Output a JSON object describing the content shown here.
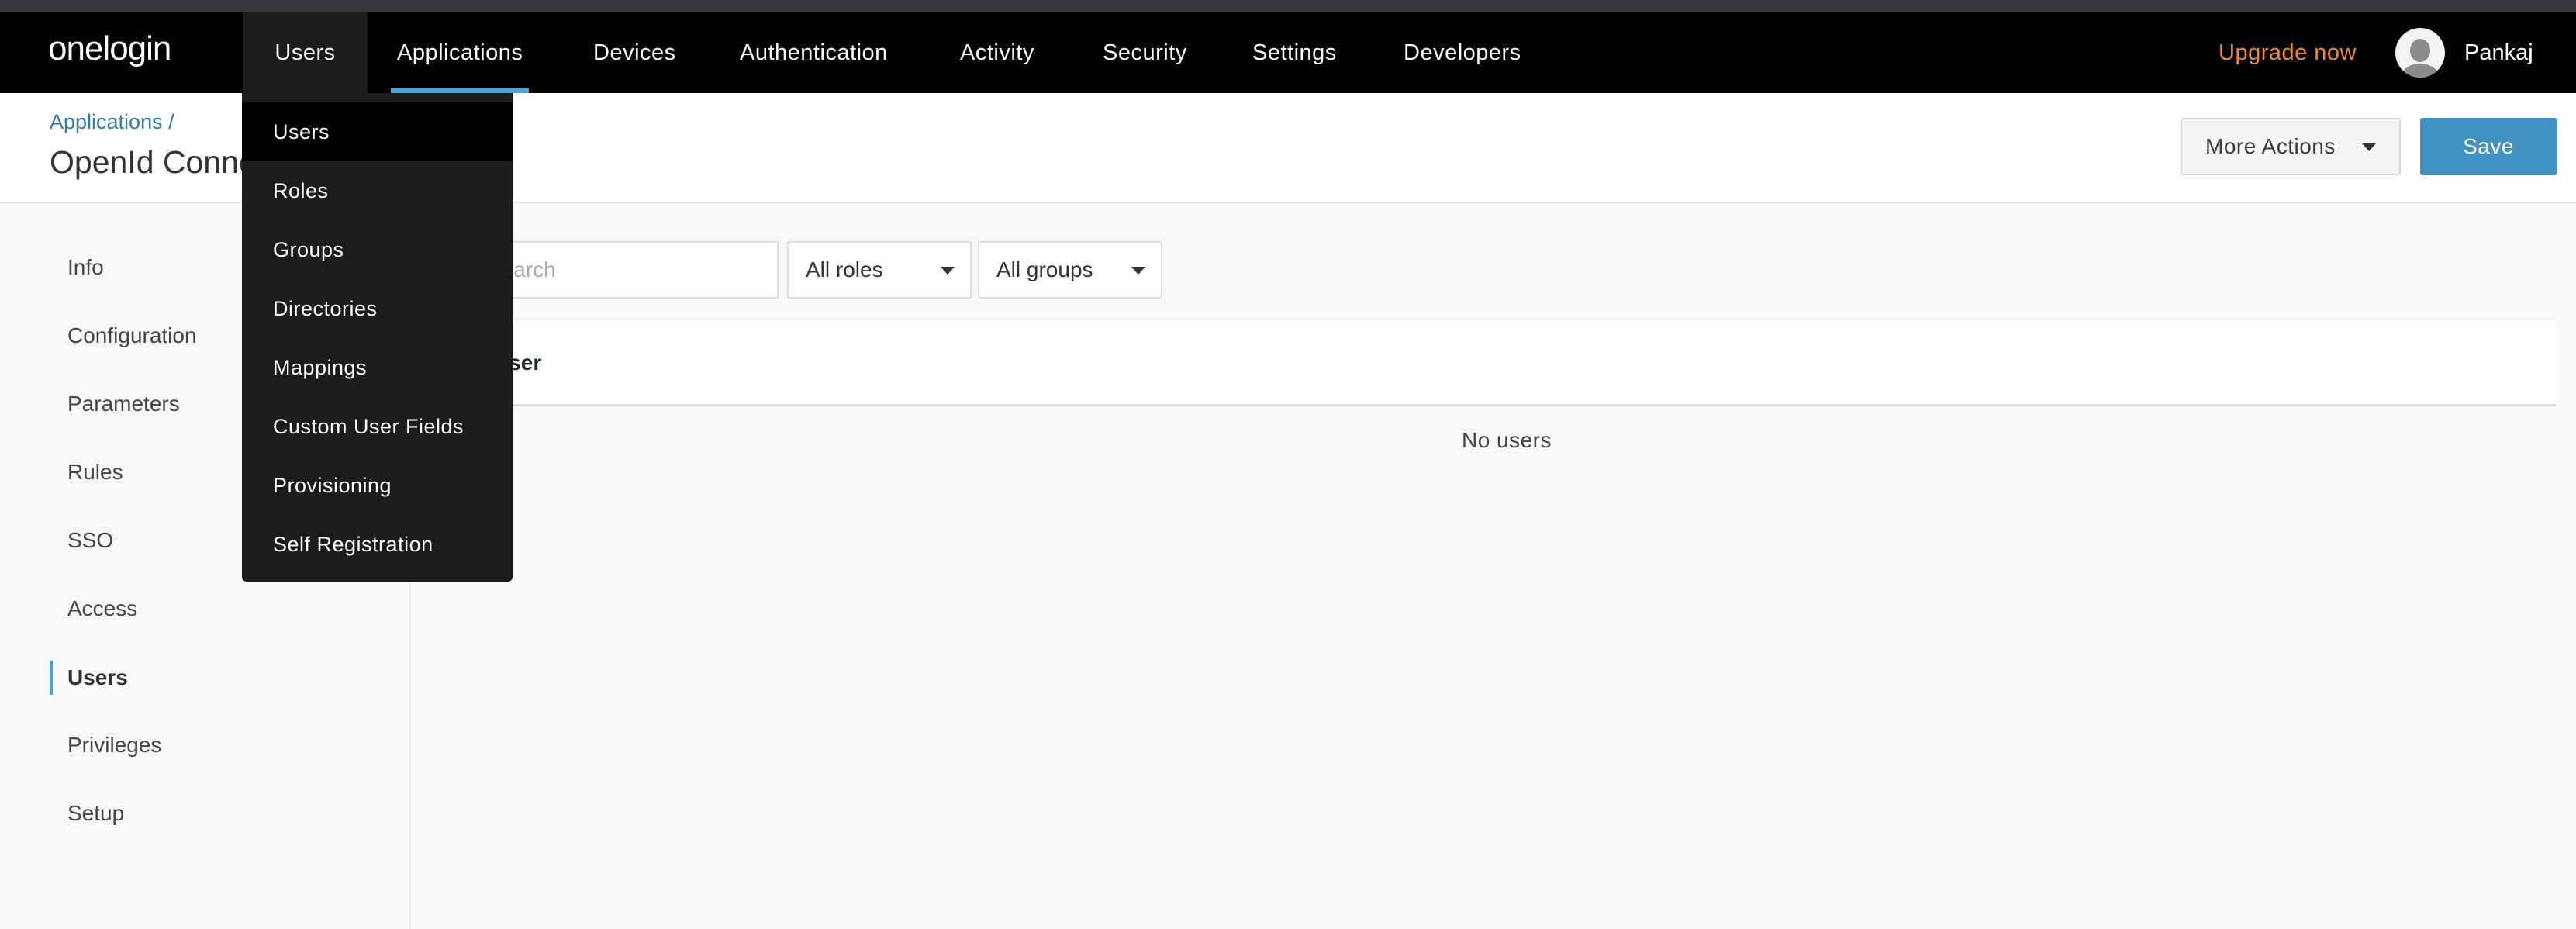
{
  "nav": {
    "logo": "onelogin",
    "items": [
      "Users",
      "Applications",
      "Devices",
      "Authentication",
      "Activity",
      "Security",
      "Settings",
      "Developers"
    ],
    "open_item": "Users",
    "active_item": "Applications",
    "upgrade": "Upgrade now",
    "user": "Pankaj"
  },
  "colors": {
    "accent": "#44a6db",
    "upgrade": "#f18a2c",
    "save": "#3f92c2"
  },
  "header": {
    "breadcrumb": "Applications /",
    "title": "OpenId Connect",
    "more_actions": "More Actions",
    "save": "Save"
  },
  "sidebar": {
    "items": [
      "Info",
      "Configuration",
      "Parameters",
      "Rules",
      "SSO",
      "Access",
      "Users",
      "Privileges",
      "Setup"
    ],
    "active": "Users"
  },
  "main": {
    "search_placeholder": "Search",
    "roles_select": "All roles",
    "groups_select": "All groups",
    "column_header": "User",
    "empty_text": "No users"
  },
  "users_menu": {
    "items": [
      "Users",
      "Roles",
      "Groups",
      "Directories",
      "Mappings",
      "Custom User Fields",
      "Provisioning",
      "Self Registration"
    ],
    "highlighted": "Users"
  }
}
